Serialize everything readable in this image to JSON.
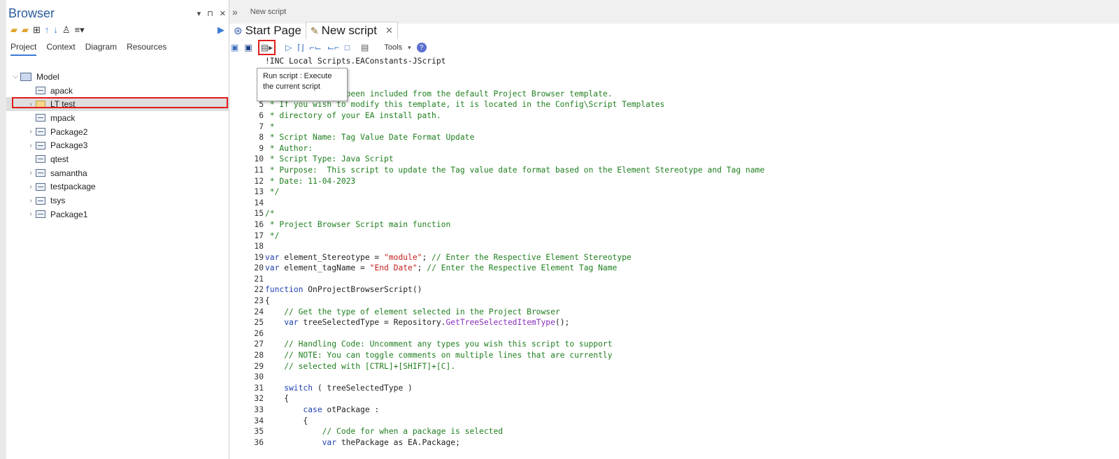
{
  "browser": {
    "title": "Browser",
    "controls": {
      "dropdown": "▾",
      "pin": "⊓",
      "close": "✕"
    },
    "tabs": [
      "Project",
      "Context",
      "Diagram",
      "Resources"
    ],
    "root": "Model",
    "items": [
      {
        "label": "apack",
        "expandable": false
      },
      {
        "label": "LT test",
        "expandable": true,
        "selected": true
      },
      {
        "label": "mpack",
        "expandable": false
      },
      {
        "label": "Package2",
        "expandable": true
      },
      {
        "label": "Package3",
        "expandable": true
      },
      {
        "label": "qtest",
        "expandable": false
      },
      {
        "label": "samantha",
        "expandable": true
      },
      {
        "label": "testpackage",
        "expandable": true
      },
      {
        "label": "tsys",
        "expandable": true
      },
      {
        "label": "Package1",
        "expandable": true
      }
    ]
  },
  "topbar": {
    "chevron": "»",
    "title": "New script"
  },
  "doctabs": {
    "start_page": "Start Page",
    "new_script": "New script",
    "close": "✕"
  },
  "toolbar": {
    "tools_label": "Tools",
    "help": "?"
  },
  "tooltip": {
    "line1": "Run script : Execute",
    "line2": "the current script"
  },
  "code_lines": [
    {
      "n": "",
      "t": "!INC Local Scripts.EAConstants-JScript",
      "c": "fn"
    },
    {
      "n": "",
      "t": "",
      "c": "comment"
    },
    {
      "n": "",
      "t": "",
      "c": "comment"
    },
    {
      "n": "",
      "t": " * This code has been included from the default Project Browser template.",
      "c": "comment"
    },
    {
      "n": "5",
      "t": " * If you wish to modify this template, it is located in the Config\\Script Templates",
      "c": "comment"
    },
    {
      "n": "6",
      "t": " * directory of your EA install path.",
      "c": "comment"
    },
    {
      "n": "7",
      "t": " *",
      "c": "comment"
    },
    {
      "n": "8",
      "t": " * Script Name: Tag Value Date Format Update",
      "c": "comment"
    },
    {
      "n": "9",
      "t": " * Author:",
      "c": "comment"
    },
    {
      "n": "10",
      "t": " * Script Type: Java Script",
      "c": "comment"
    },
    {
      "n": "11",
      "t": " * Purpose:  This script to update the Tag value date format based on the Element Stereotype and Tag name",
      "c": "comment"
    },
    {
      "n": "12",
      "t": " * Date: 11-04-2023",
      "c": "comment"
    },
    {
      "n": "13",
      "t": " */",
      "c": "comment"
    },
    {
      "n": "14",
      "t": "",
      "c": "comment"
    },
    {
      "n": "15",
      "t": "/*",
      "c": "comment"
    },
    {
      "n": "16",
      "t": " * Project Browser Script main function",
      "c": "comment"
    },
    {
      "n": "17",
      "t": " */",
      "c": "comment"
    },
    {
      "n": "18",
      "t": "",
      "c": "comment"
    },
    {
      "n": "19",
      "t": "",
      "c": "mixed19"
    },
    {
      "n": "20",
      "t": "",
      "c": "mixed20"
    },
    {
      "n": "21",
      "t": "",
      "c": "comment"
    },
    {
      "n": "22",
      "t": "",
      "c": "mixed22"
    },
    {
      "n": "23",
      "t": "{",
      "c": "fn"
    },
    {
      "n": "24",
      "t": "    // Get the type of element selected in the Project Browser",
      "c": "comment"
    },
    {
      "n": "25",
      "t": "",
      "c": "mixed25"
    },
    {
      "n": "26",
      "t": "",
      "c": "comment"
    },
    {
      "n": "27",
      "t": "    // Handling Code: Uncomment any types you wish this script to support",
      "c": "comment"
    },
    {
      "n": "28",
      "t": "    // NOTE: You can toggle comments on multiple lines that are currently",
      "c": "comment"
    },
    {
      "n": "29",
      "t": "    // selected with [CTRL]+[SHIFT]+[C].",
      "c": "comment"
    },
    {
      "n": "30",
      "t": "",
      "c": "comment"
    },
    {
      "n": "31",
      "t": "",
      "c": "mixed31"
    },
    {
      "n": "32",
      "t": "    {",
      "c": "fn"
    },
    {
      "n": "33",
      "t": "",
      "c": "mixed33"
    },
    {
      "n": "34",
      "t": "        {",
      "c": "fn"
    },
    {
      "n": "35",
      "t": "            // Code for when a package is selected",
      "c": "comment"
    },
    {
      "n": "36",
      "t": "",
      "c": "mixed36"
    }
  ],
  "code_parts": {
    "l19": {
      "kw": "var",
      "a": " element_Stereotype = ",
      "s": "\"module\"",
      "b": "; ",
      "c": "// Enter the Respective Element Stereotype"
    },
    "l20": {
      "kw": "var",
      "a": " element_tagName = ",
      "s": "\"End Date\"",
      "b": "; ",
      "c": "// Enter the Respective Element Tag Name"
    },
    "l22": {
      "kw": "function",
      "a": " OnProjectBrowserScript()"
    },
    "l25": {
      "kw": "    var",
      "a": " treeSelectedType = Repository.",
      "m": "GetTreeSelectedItemType",
      "b": "();"
    },
    "l31": {
      "kw": "    switch",
      "a": " ( treeSelectedType )"
    },
    "l33": {
      "kw": "        case",
      "a": " otPackage :"
    },
    "l36": {
      "kw": "            var",
      "a": " thePackage as EA.Package;"
    }
  }
}
